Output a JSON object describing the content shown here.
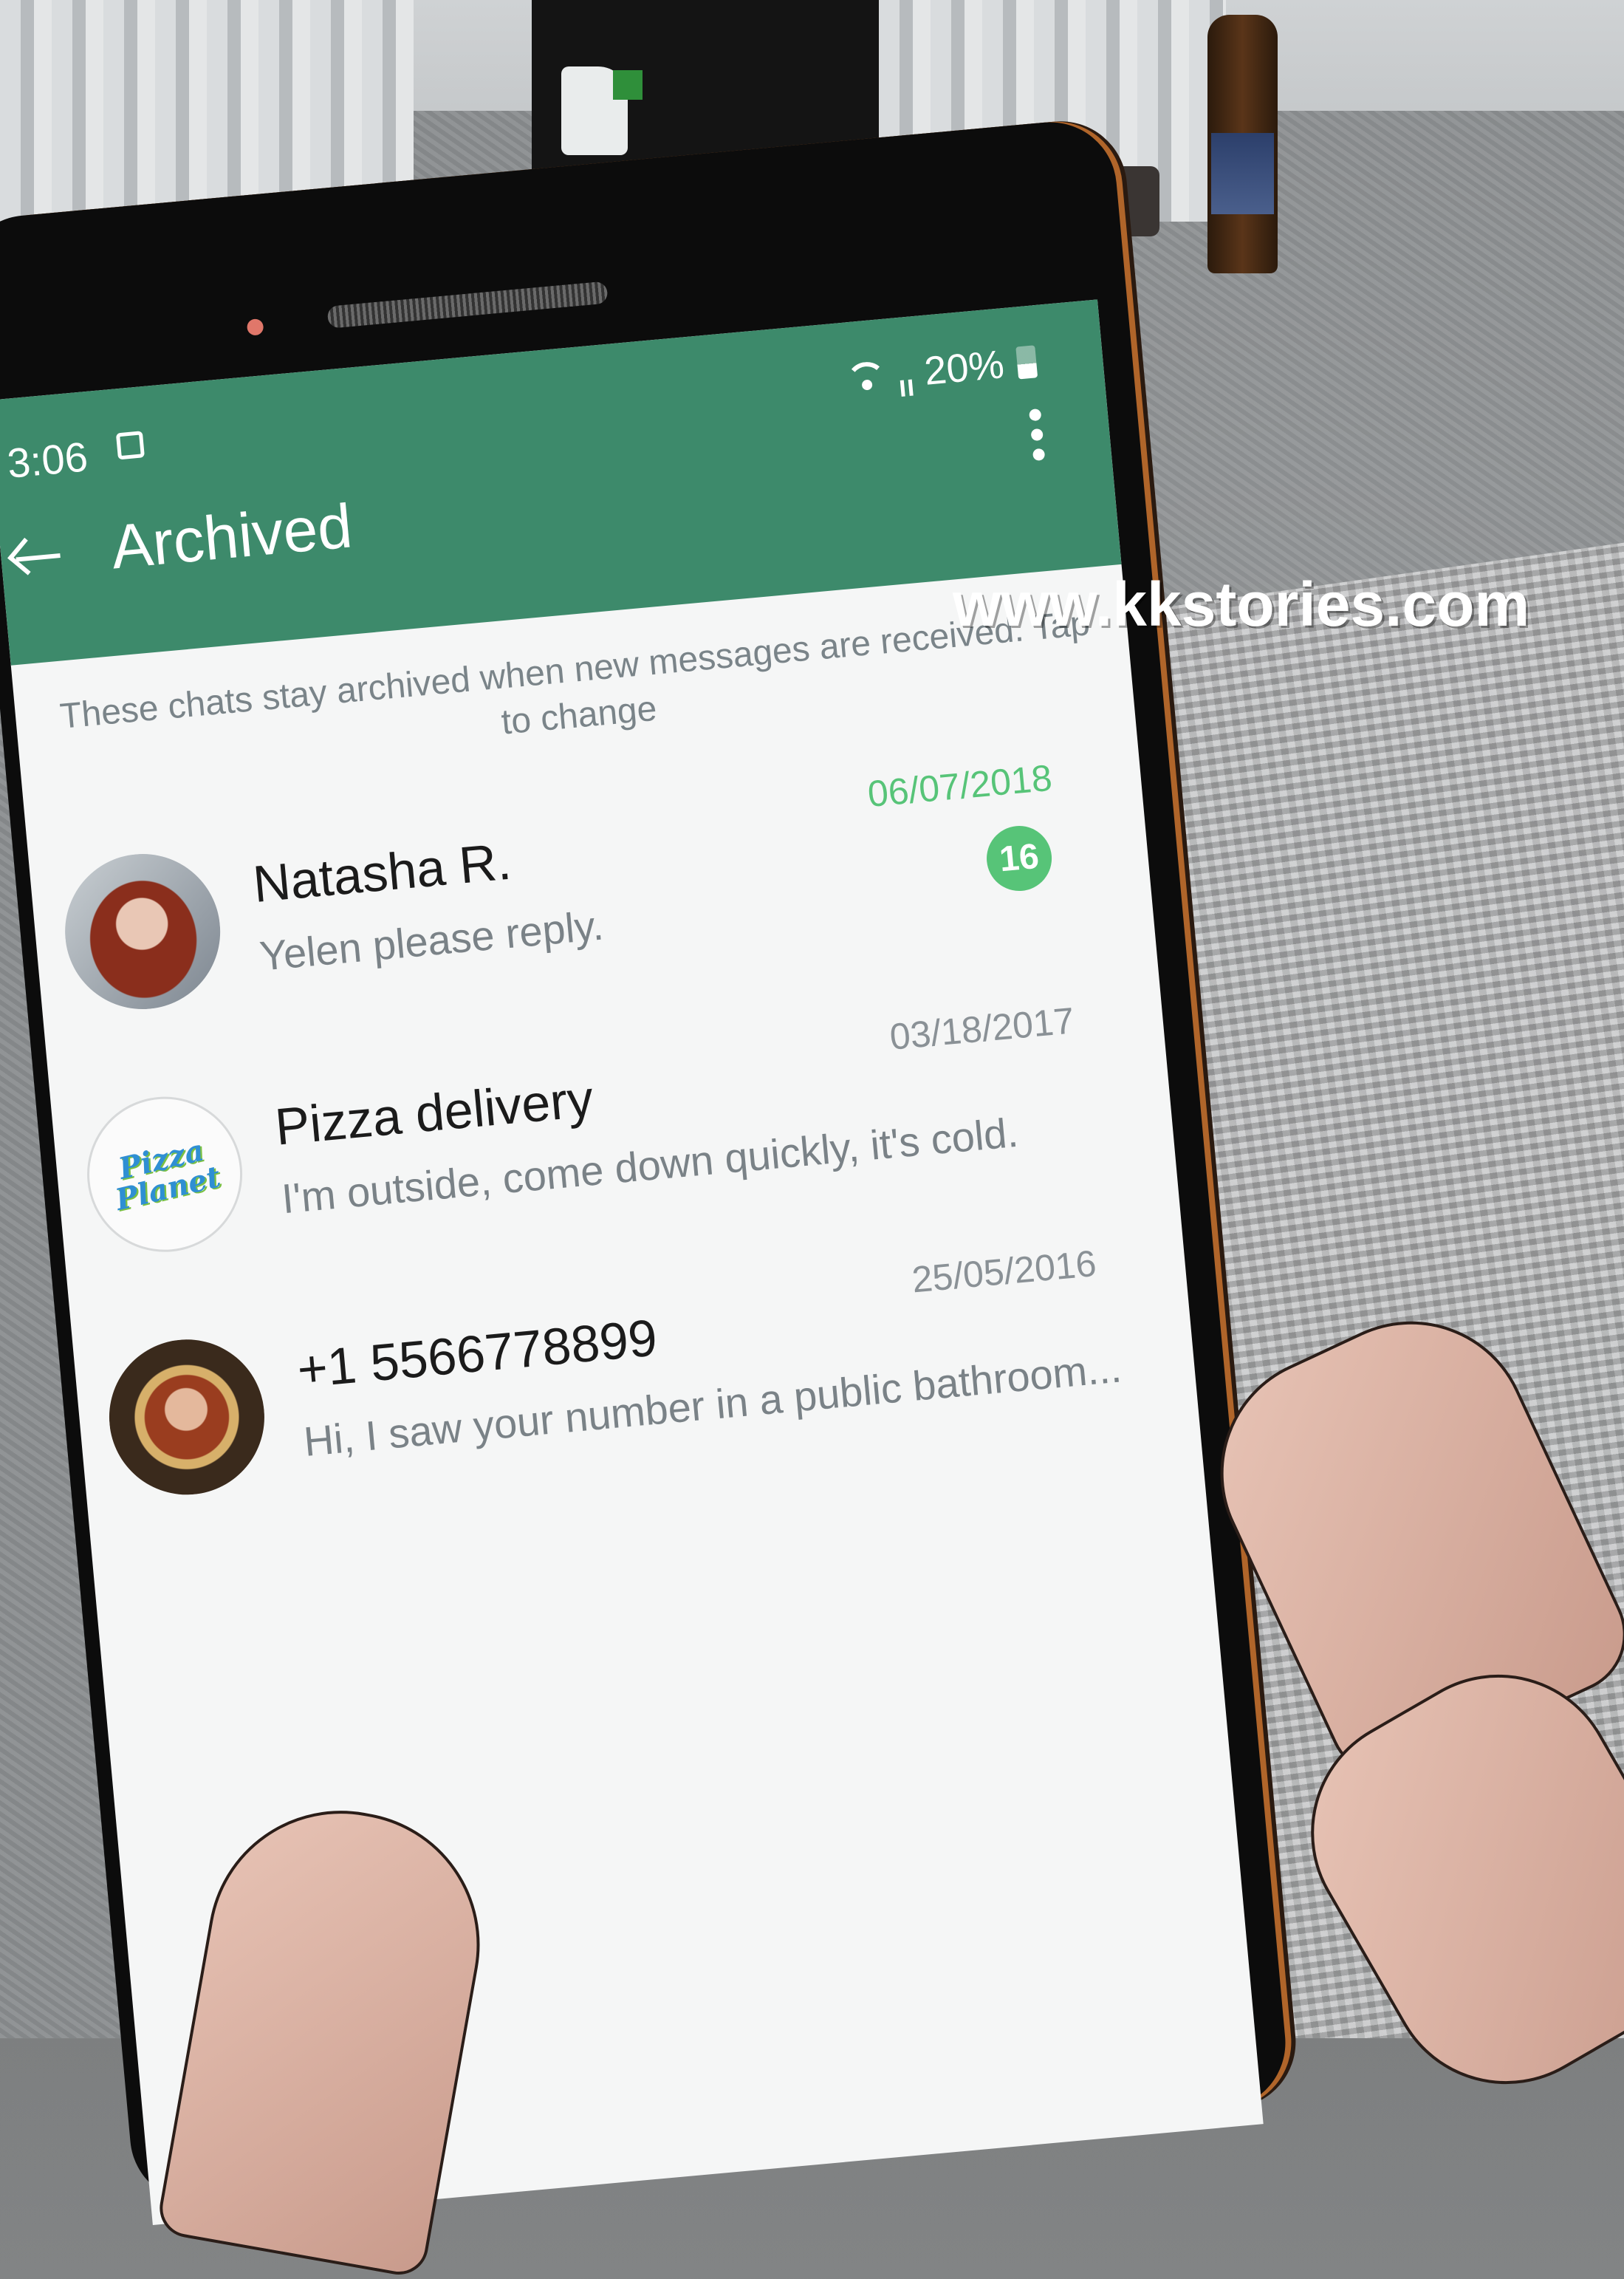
{
  "status_bar": {
    "time": "3:06",
    "battery": "20%"
  },
  "appbar": {
    "title": "Archived"
  },
  "notice": "These chats stay archived when new messages are received. Tap to change",
  "chats": [
    {
      "name": "Natasha R.",
      "preview": "Yelen please reply.",
      "date": "06/07/2018",
      "unread": "16"
    },
    {
      "name": "Pizza delivery",
      "preview": "I'm outside, come down quickly, it's cold.",
      "date": "03/18/2017"
    },
    {
      "name": "+1 5566778899",
      "preview": "Hi, I saw your number in a public bathroom...",
      "date": "25/05/2016"
    }
  ],
  "pizza_logo": "Pizza Planet",
  "watermark": "www.kkstories.com",
  "colors": {
    "appbar": "#3d8a6b",
    "unread": "#57c478"
  },
  "icons": [
    "back-arrow-icon",
    "more-vert-icon",
    "wifi-icon",
    "signal-icon",
    "battery-icon"
  ]
}
